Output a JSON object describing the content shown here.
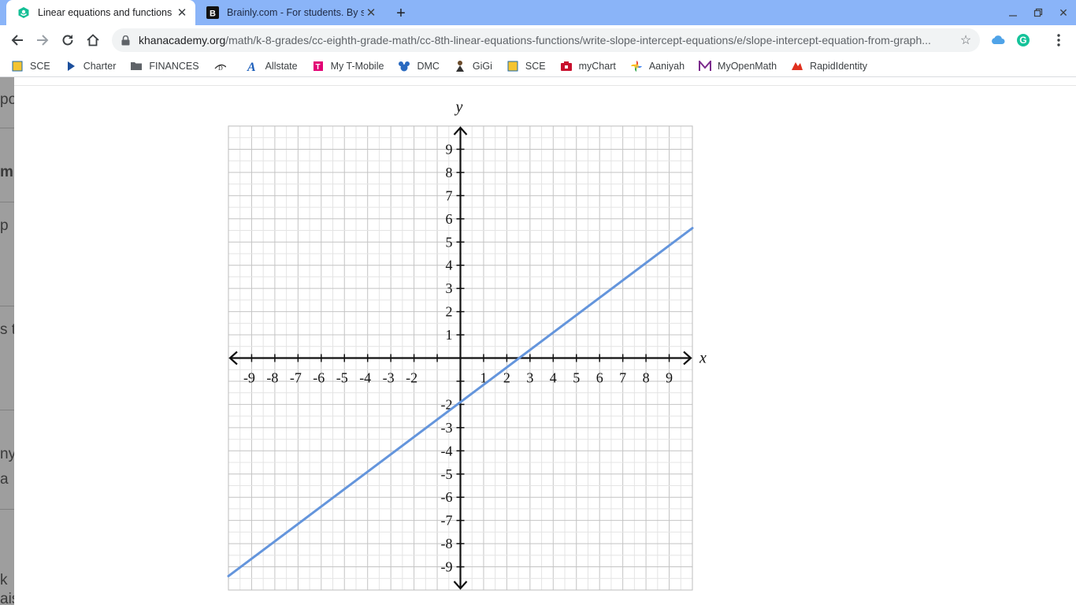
{
  "browser": {
    "tabs": [
      {
        "title": "Linear equations and functions |",
        "icon": "khan-academy-icon",
        "active": true
      },
      {
        "title": "Brainly.com - For students. By st",
        "icon": "brainly-icon",
        "active": false
      }
    ],
    "url_host": "khanacademy.org",
    "url_path": "/math/k-8-grades/cc-eighth-grade-math/cc-8th-linear-equations-functions/write-slope-intercept-equations/e/slope-intercept-equation-from-graph...",
    "bookmarks": [
      {
        "label": "SCE",
        "icon": "sce-icon"
      },
      {
        "label": "Charter",
        "icon": "play-icon"
      },
      {
        "label": "FINANCES",
        "icon": "folder-icon"
      },
      {
        "label": "",
        "icon": "disney-icon"
      },
      {
        "label": "Allstate",
        "icon": "allstate-icon"
      },
      {
        "label": "My T-Mobile",
        "icon": "tmobile-icon"
      },
      {
        "label": "DMC",
        "icon": "dmc-icon"
      },
      {
        "label": "GiGi",
        "icon": "gigi-icon"
      },
      {
        "label": "SCE",
        "icon": "sce-icon"
      },
      {
        "label": "myChart",
        "icon": "mychart-icon"
      },
      {
        "label": "Aaniyah",
        "icon": "photos-icon"
      },
      {
        "label": "MyOpenMath",
        "icon": "myopenmath-icon"
      },
      {
        "label": "RapidIdentity",
        "icon": "rapididentity-icon"
      }
    ],
    "colors": {
      "tabstrip": "#8ab4f8",
      "accent": "#1a73e8"
    }
  },
  "sidebar_fragments": [
    "po",
    "mi",
    "p",
    "s to",
    "ny",
    "a",
    "k",
    "ais"
  ],
  "chart_data": {
    "type": "line",
    "xlabel": "x",
    "ylabel": "y",
    "xlim": [
      -10,
      10
    ],
    "ylim": [
      -10,
      10
    ],
    "grid": true,
    "x_ticks": [
      "-9",
      "-8",
      "-7",
      "-6",
      "-5",
      "-4",
      "-3",
      "-2",
      "1",
      "2",
      "3",
      "4",
      "5",
      "6",
      "7",
      "8",
      "9"
    ],
    "y_ticks": [
      "9",
      "8",
      "7",
      "6",
      "5",
      "4",
      "3",
      "2",
      "1",
      "-2",
      "-3",
      "-4",
      "-5",
      "-6",
      "-7",
      "-8",
      "-9"
    ],
    "series": [
      {
        "points": [
          [
            -10,
            -9.4
          ],
          [
            10,
            5.6
          ]
        ],
        "color": "#6495dc"
      }
    ]
  }
}
